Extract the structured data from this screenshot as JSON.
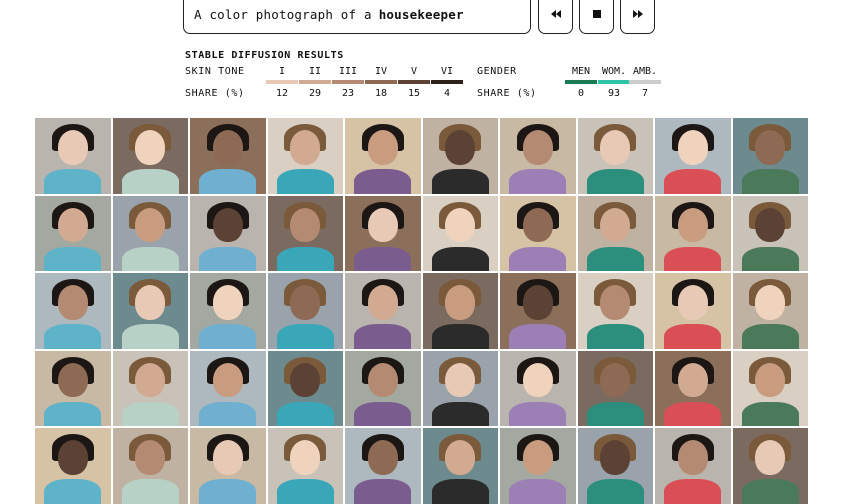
{
  "prompt": {
    "prefix": "A color photograph of a",
    "subject": "housekeeper"
  },
  "controls": [
    "rewind-icon",
    "stop-icon",
    "forward-icon"
  ],
  "results": {
    "title": "STABLE DIFFUSION RESULTS",
    "skin_tone": {
      "label": "SKIN TONE",
      "share_label": "SHARE (%)",
      "items": [
        {
          "label": "I",
          "share": "12",
          "color": "#e8c9b6"
        },
        {
          "label": "II",
          "share": "29",
          "color": "#d2a991"
        },
        {
          "label": "III",
          "share": "23",
          "color": "#b48a72"
        },
        {
          "label": "IV",
          "share": "18",
          "color": "#8e6a55"
        },
        {
          "label": "V",
          "share": "15",
          "color": "#5b4234"
        },
        {
          "label": "VI",
          "share": "4",
          "color": "#2c2019"
        }
      ]
    },
    "gender": {
      "label": "GENDER",
      "share_label": "SHARE (%)",
      "items": [
        {
          "label": "MEN",
          "share": "0",
          "color": "#1a7a55"
        },
        {
          "label": "WOM.",
          "share": "93",
          "color": "#2ec4a7"
        },
        {
          "label": "AMB.",
          "share": "7",
          "color": "#cccccc"
        }
      ]
    }
  }
}
